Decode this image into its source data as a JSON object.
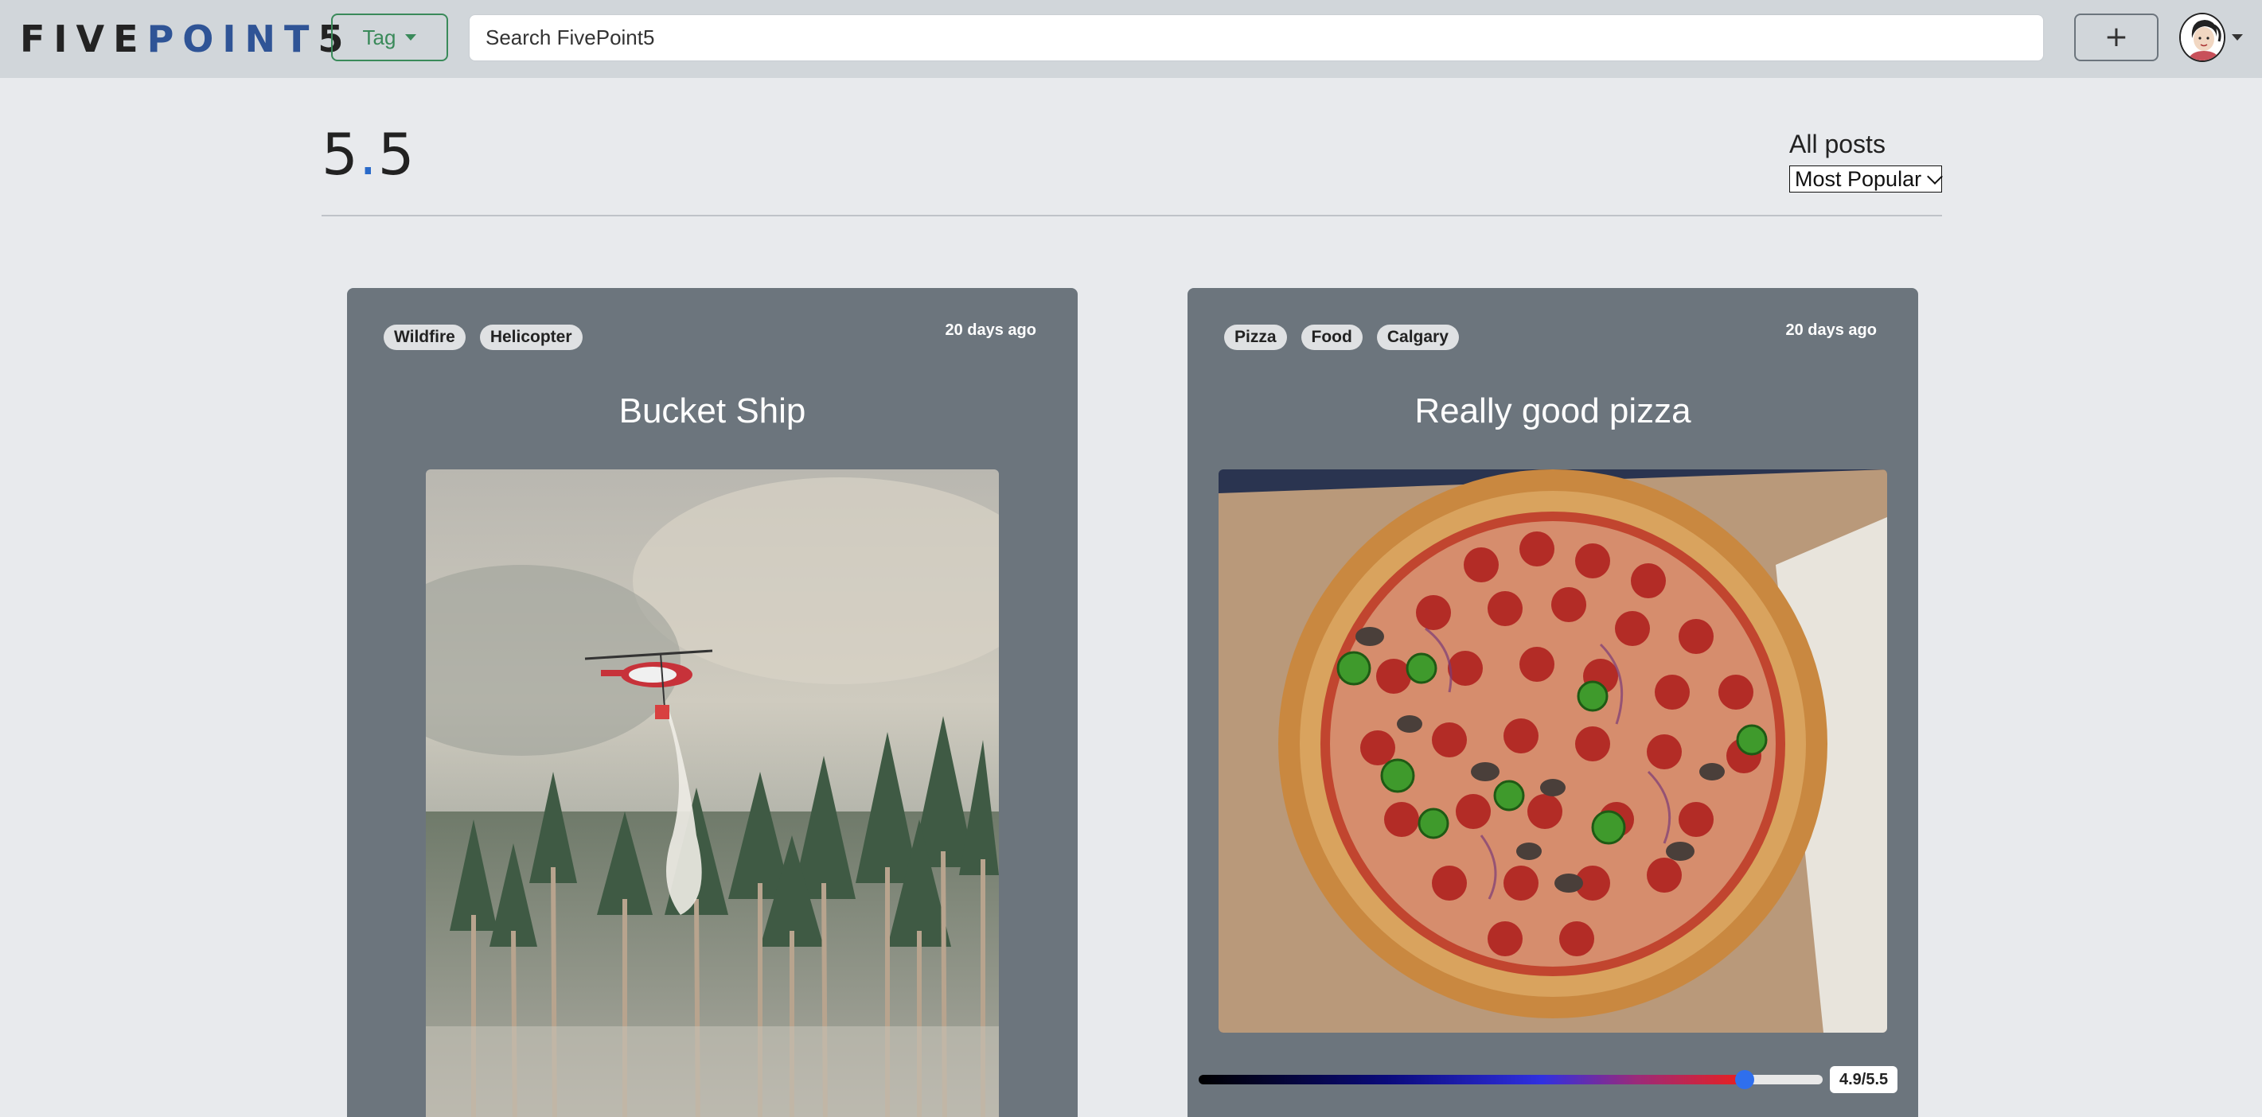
{
  "navbar": {
    "brand_part1": "FIVE",
    "brand_part2": "POINT",
    "brand_part3": "5",
    "tag_button_label": "Tag",
    "search_placeholder": "Search FivePoint5",
    "add_button_label": "+"
  },
  "header": {
    "logo_whole": "5",
    "logo_dot": ".",
    "logo_decimal": "5",
    "posts_label": "All posts",
    "sort_selected": "Most Popular"
  },
  "posts": [
    {
      "tags": [
        "Wildfire",
        "Helicopter"
      ],
      "time": "20 days ago",
      "title": "Bucket Ship"
    },
    {
      "tags": [
        "Pizza",
        "Food",
        "Calgary"
      ],
      "time": "20 days ago",
      "title": "Really good pizza",
      "rating_value": 4.9,
      "rating_max": 5.5,
      "rating_label": "4.9/5.5"
    }
  ],
  "colors": {
    "accent_blue": "#2f5496",
    "tag_green": "#3a8a5a",
    "card_bg": "#6c757d",
    "slider_thumb": "#2f6fed"
  }
}
